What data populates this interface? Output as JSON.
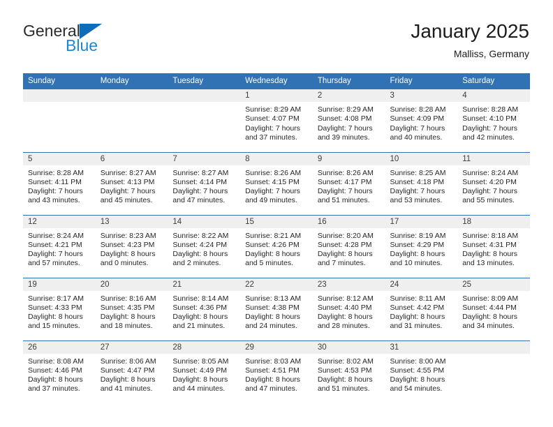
{
  "brand": {
    "name_part1": "General",
    "name_part2": "Blue",
    "triangle_icon": "triangle-icon",
    "colors": {
      "dark_text": "#2b2b2b",
      "blue_text": "#1a87d8",
      "triangle": "#0f6cb8"
    }
  },
  "header": {
    "title": "January 2025",
    "subtitle": "Malliss, Germany"
  },
  "theme": {
    "header_blue": "#3072b4",
    "daynum_band": "#efefef",
    "row_divider": "#3072b4",
    "body_text": "#262626"
  },
  "calendar": {
    "weekday_headers": [
      "Sunday",
      "Monday",
      "Tuesday",
      "Wednesday",
      "Thursday",
      "Friday",
      "Saturday"
    ],
    "weeks": [
      [
        {
          "day": "",
          "lines": []
        },
        {
          "day": "",
          "lines": []
        },
        {
          "day": "",
          "lines": []
        },
        {
          "day": "1",
          "lines": [
            "Sunrise: 8:29 AM",
            "Sunset: 4:07 PM",
            "Daylight: 7 hours",
            "and 37 minutes."
          ]
        },
        {
          "day": "2",
          "lines": [
            "Sunrise: 8:29 AM",
            "Sunset: 4:08 PM",
            "Daylight: 7 hours",
            "and 39 minutes."
          ]
        },
        {
          "day": "3",
          "lines": [
            "Sunrise: 8:28 AM",
            "Sunset: 4:09 PM",
            "Daylight: 7 hours",
            "and 40 minutes."
          ]
        },
        {
          "day": "4",
          "lines": [
            "Sunrise: 8:28 AM",
            "Sunset: 4:10 PM",
            "Daylight: 7 hours",
            "and 42 minutes."
          ]
        }
      ],
      [
        {
          "day": "5",
          "lines": [
            "Sunrise: 8:28 AM",
            "Sunset: 4:11 PM",
            "Daylight: 7 hours",
            "and 43 minutes."
          ]
        },
        {
          "day": "6",
          "lines": [
            "Sunrise: 8:27 AM",
            "Sunset: 4:13 PM",
            "Daylight: 7 hours",
            "and 45 minutes."
          ]
        },
        {
          "day": "7",
          "lines": [
            "Sunrise: 8:27 AM",
            "Sunset: 4:14 PM",
            "Daylight: 7 hours",
            "and 47 minutes."
          ]
        },
        {
          "day": "8",
          "lines": [
            "Sunrise: 8:26 AM",
            "Sunset: 4:15 PM",
            "Daylight: 7 hours",
            "and 49 minutes."
          ]
        },
        {
          "day": "9",
          "lines": [
            "Sunrise: 8:26 AM",
            "Sunset: 4:17 PM",
            "Daylight: 7 hours",
            "and 51 minutes."
          ]
        },
        {
          "day": "10",
          "lines": [
            "Sunrise: 8:25 AM",
            "Sunset: 4:18 PM",
            "Daylight: 7 hours",
            "and 53 minutes."
          ]
        },
        {
          "day": "11",
          "lines": [
            "Sunrise: 8:24 AM",
            "Sunset: 4:20 PM",
            "Daylight: 7 hours",
            "and 55 minutes."
          ]
        }
      ],
      [
        {
          "day": "12",
          "lines": [
            "Sunrise: 8:24 AM",
            "Sunset: 4:21 PM",
            "Daylight: 7 hours",
            "and 57 minutes."
          ]
        },
        {
          "day": "13",
          "lines": [
            "Sunrise: 8:23 AM",
            "Sunset: 4:23 PM",
            "Daylight: 8 hours",
            "and 0 minutes."
          ]
        },
        {
          "day": "14",
          "lines": [
            "Sunrise: 8:22 AM",
            "Sunset: 4:24 PM",
            "Daylight: 8 hours",
            "and 2 minutes."
          ]
        },
        {
          "day": "15",
          "lines": [
            "Sunrise: 8:21 AM",
            "Sunset: 4:26 PM",
            "Daylight: 8 hours",
            "and 5 minutes."
          ]
        },
        {
          "day": "16",
          "lines": [
            "Sunrise: 8:20 AM",
            "Sunset: 4:28 PM",
            "Daylight: 8 hours",
            "and 7 minutes."
          ]
        },
        {
          "day": "17",
          "lines": [
            "Sunrise: 8:19 AM",
            "Sunset: 4:29 PM",
            "Daylight: 8 hours",
            "and 10 minutes."
          ]
        },
        {
          "day": "18",
          "lines": [
            "Sunrise: 8:18 AM",
            "Sunset: 4:31 PM",
            "Daylight: 8 hours",
            "and 13 minutes."
          ]
        }
      ],
      [
        {
          "day": "19",
          "lines": [
            "Sunrise: 8:17 AM",
            "Sunset: 4:33 PM",
            "Daylight: 8 hours",
            "and 15 minutes."
          ]
        },
        {
          "day": "20",
          "lines": [
            "Sunrise: 8:16 AM",
            "Sunset: 4:35 PM",
            "Daylight: 8 hours",
            "and 18 minutes."
          ]
        },
        {
          "day": "21",
          "lines": [
            "Sunrise: 8:14 AM",
            "Sunset: 4:36 PM",
            "Daylight: 8 hours",
            "and 21 minutes."
          ]
        },
        {
          "day": "22",
          "lines": [
            "Sunrise: 8:13 AM",
            "Sunset: 4:38 PM",
            "Daylight: 8 hours",
            "and 24 minutes."
          ]
        },
        {
          "day": "23",
          "lines": [
            "Sunrise: 8:12 AM",
            "Sunset: 4:40 PM",
            "Daylight: 8 hours",
            "and 28 minutes."
          ]
        },
        {
          "day": "24",
          "lines": [
            "Sunrise: 8:11 AM",
            "Sunset: 4:42 PM",
            "Daylight: 8 hours",
            "and 31 minutes."
          ]
        },
        {
          "day": "25",
          "lines": [
            "Sunrise: 8:09 AM",
            "Sunset: 4:44 PM",
            "Daylight: 8 hours",
            "and 34 minutes."
          ]
        }
      ],
      [
        {
          "day": "26",
          "lines": [
            "Sunrise: 8:08 AM",
            "Sunset: 4:46 PM",
            "Daylight: 8 hours",
            "and 37 minutes."
          ]
        },
        {
          "day": "27",
          "lines": [
            "Sunrise: 8:06 AM",
            "Sunset: 4:47 PM",
            "Daylight: 8 hours",
            "and 41 minutes."
          ]
        },
        {
          "day": "28",
          "lines": [
            "Sunrise: 8:05 AM",
            "Sunset: 4:49 PM",
            "Daylight: 8 hours",
            "and 44 minutes."
          ]
        },
        {
          "day": "29",
          "lines": [
            "Sunrise: 8:03 AM",
            "Sunset: 4:51 PM",
            "Daylight: 8 hours",
            "and 47 minutes."
          ]
        },
        {
          "day": "30",
          "lines": [
            "Sunrise: 8:02 AM",
            "Sunset: 4:53 PM",
            "Daylight: 8 hours",
            "and 51 minutes."
          ]
        },
        {
          "day": "31",
          "lines": [
            "Sunrise: 8:00 AM",
            "Sunset: 4:55 PM",
            "Daylight: 8 hours",
            "and 54 minutes."
          ]
        },
        {
          "day": "",
          "lines": []
        }
      ]
    ]
  }
}
